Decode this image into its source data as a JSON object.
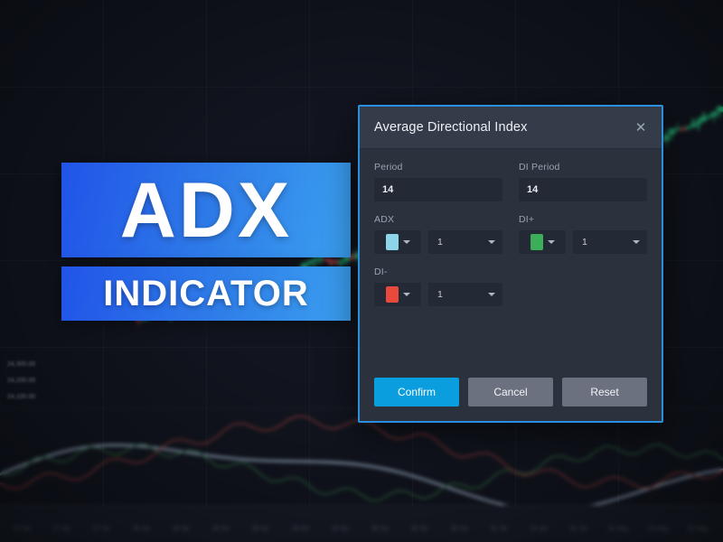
{
  "banner": {
    "line1": "ADX",
    "line2": "INDICATOR",
    "gradient_start": "#2154e8",
    "gradient_end": "#3ba0f0"
  },
  "dialog": {
    "title": "Average Directional Index",
    "close_icon": "close-icon",
    "accent_color": "#2b8fe0",
    "fields": {
      "period": {
        "label": "Period",
        "value": "14"
      },
      "di_period": {
        "label": "DI Period",
        "value": "14"
      }
    },
    "lines": [
      {
        "label": "ADX",
        "color": "#8ed4e8",
        "width": "1"
      },
      {
        "label": "DI+",
        "color": "#3cae5a",
        "width": "1"
      },
      {
        "label": "DI-",
        "color": "#e8493c",
        "width": "1"
      }
    ],
    "buttons": {
      "confirm": "Confirm",
      "cancel": "Cancel",
      "reset": "Reset"
    }
  },
  "chart_background": {
    "up_color": "#26c281",
    "down_color": "#e8505b",
    "adx_line_color": "#9fb4cc",
    "di_plus_color": "#2f6b43",
    "di_minus_color": "#8f3b38",
    "time_labels": [
      "27 Jul",
      "27 Jul",
      "27 Jul",
      "28 Jul",
      "28 Jul",
      "28 Jul",
      "29 Jul",
      "29 Jul",
      "29 Jul",
      "30 Jul",
      "30 Jul",
      "30 Jul",
      "31 Jul",
      "31 Jul",
      "31 Jul",
      "01 Aug",
      "01 Aug",
      "01 Aug"
    ],
    "price_labels": [
      "24,300.00",
      "24,200.00",
      "24,100.00"
    ]
  }
}
